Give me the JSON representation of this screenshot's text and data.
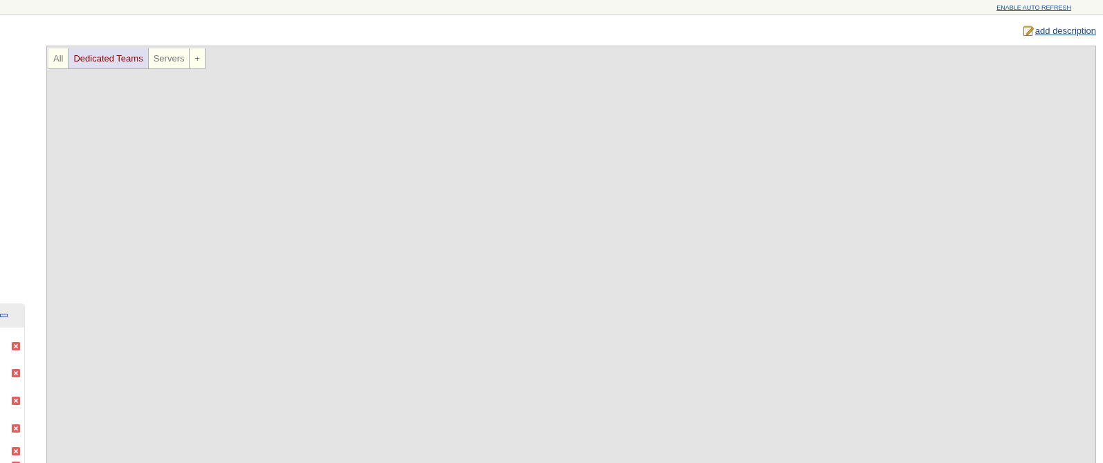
{
  "top_bar": {
    "auto_refresh_link": "ENABLE AUTO REFRESH"
  },
  "description_link": "add description",
  "tabs": [
    {
      "label": "All",
      "selected": false
    },
    {
      "label": "Dedicated Teams",
      "selected": true
    },
    {
      "label": "Servers",
      "selected": false
    },
    {
      "label": "+",
      "selected": false
    }
  ]
}
